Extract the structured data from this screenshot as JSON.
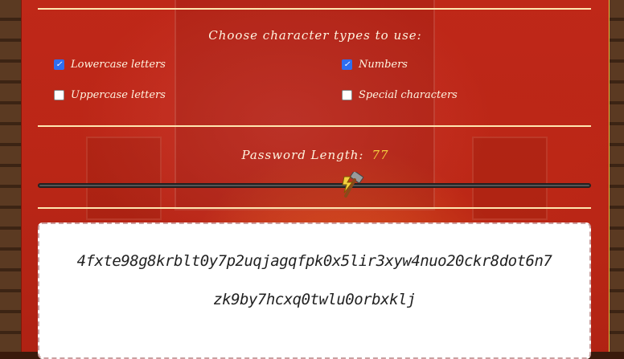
{
  "section": {
    "heading": "Choose character types to use:"
  },
  "options": [
    {
      "label": "Lowercase letters",
      "checked": true
    },
    {
      "label": "Numbers",
      "checked": true
    },
    {
      "label": "Uppercase letters",
      "checked": false
    },
    {
      "label": "Special characters",
      "checked": false
    }
  ],
  "length": {
    "label": "Password Length:",
    "value": "77",
    "fraction": 0.57
  },
  "password": {
    "line1": "4fxte98g8krblt0y7p2uqjagqfpk0x5lir3xyw4nuo20ckr8dot6n7",
    "line2": "zk9by7hcxq0twlu0orbxklj"
  },
  "colors": {
    "accent": "#f5d040",
    "checkbox": "#2e6ef0",
    "panel": "#c4281a"
  }
}
